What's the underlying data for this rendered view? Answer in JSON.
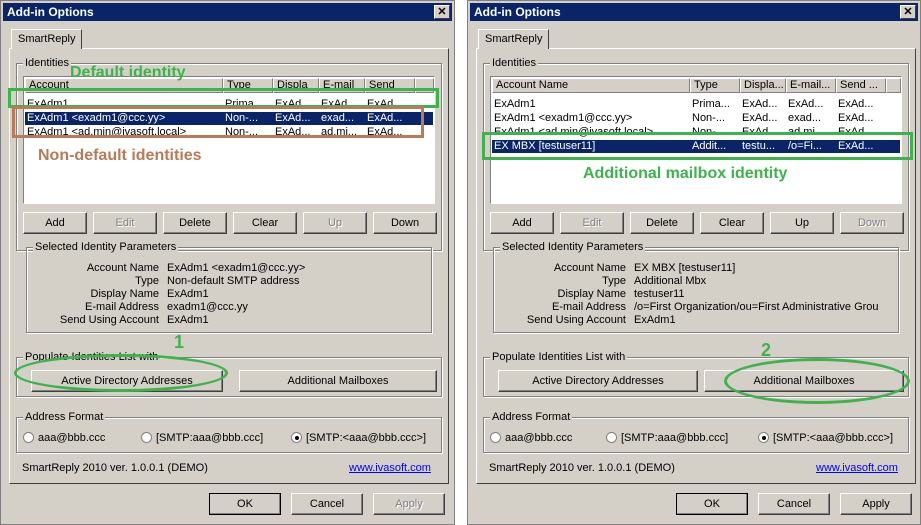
{
  "colors": {
    "green": "#3cb44b",
    "brown": "#b97a57",
    "selection": "#0a246a"
  },
  "left": {
    "title": "Add-in Options",
    "close_icon": "✕",
    "tab": "SmartReply",
    "identities_label": "Identities",
    "columns": [
      "Account",
      "Type",
      "Displa",
      "E-mail",
      "Send"
    ],
    "rows": [
      {
        "account": "ExAdm1",
        "type": "Prima...",
        "display": "ExAd...",
        "email": "ExAd...",
        "send": "ExAd...",
        "selected": false
      },
      {
        "account": "ExAdm1 <exadm1@ccc.yy>",
        "type": "Non-...",
        "display": "ExAd...",
        "email": "exad...",
        "send": "ExAd...",
        "selected": true
      },
      {
        "account": "ExAdm1 <ad.min@ivasoft.local>",
        "type": "Non-...",
        "display": "ExAd...",
        "email": "ad.mi...",
        "send": "ExAd...",
        "selected": false
      }
    ],
    "buttons": {
      "add": "Add",
      "edit": "Edit",
      "delete": "Delete",
      "clear": "Clear",
      "up": "Up",
      "down": "Down"
    },
    "params_label": "Selected Identity Parameters",
    "params": [
      {
        "label": "Account Name",
        "value": "ExAdm1 <exadm1@ccc.yy>"
      },
      {
        "label": "Type",
        "value": "Non-default SMTP address"
      },
      {
        "label": "Display Name",
        "value": "ExAdm1"
      },
      {
        "label": "E-mail Address",
        "value": "exadm1@ccc.yy"
      },
      {
        "label": "Send Using Account",
        "value": "ExAdm1"
      }
    ],
    "populate_label": "Populate Identities List with",
    "populate_ad": "Active Directory Addresses",
    "populate_mbx": "Additional Mailboxes",
    "format_label": "Address Format",
    "formats": [
      "aaa@bbb.ccc",
      "[SMTP:aaa@bbb.ccc]",
      "[SMTP:<aaa@bbb.ccc>]"
    ],
    "version": "SmartReply 2010 ver. 1.0.0.1 (DEMO)",
    "link": "www.ivasoft.com",
    "ok": "OK",
    "cancel": "Cancel",
    "apply": "Apply",
    "ann_default": "Default identity",
    "ann_nondefault": "Non-default identities",
    "ann_num": "1"
  },
  "right": {
    "title": "Add-in Options",
    "close_icon": "✕",
    "tab": "SmartReply",
    "identities_label": "Identities",
    "columns": [
      "Account Name",
      "Type",
      "Displa...",
      "E-mail...",
      "Send ..."
    ],
    "rows": [
      {
        "account": "ExAdm1",
        "type": "Prima...",
        "display": "ExAd...",
        "email": "ExAd...",
        "send": "ExAd...",
        "selected": false
      },
      {
        "account": "ExAdm1 <exadm1@ccc.yy>",
        "type": "Non-...",
        "display": "ExAd...",
        "email": "exad...",
        "send": "ExAd...",
        "selected": false
      },
      {
        "account": "ExAdm1 <ad.min@ivasoft.local>",
        "type": "Non-...",
        "display": "ExAd...",
        "email": "ad.mi...",
        "send": "ExAd...",
        "selected": false
      },
      {
        "account": "EX MBX [testuser11]",
        "type": "Addit...",
        "display": "testu...",
        "email": "/o=Fi...",
        "send": "ExAd...",
        "selected": true
      }
    ],
    "buttons": {
      "add": "Add",
      "edit": "Edit",
      "delete": "Delete",
      "clear": "Clear",
      "up": "Up",
      "down": "Down"
    },
    "params_label": "Selected Identity Parameters",
    "params": [
      {
        "label": "Account Name",
        "value": "EX MBX [testuser11]"
      },
      {
        "label": "Type",
        "value": "Additional Mbx"
      },
      {
        "label": "Display Name",
        "value": "testuser11"
      },
      {
        "label": "E-mail Address",
        "value": "/o=First  Organization/ou=First  Administrative Grou"
      },
      {
        "label": "Send Using Account",
        "value": "ExAdm1"
      }
    ],
    "populate_label": "Populate Identities List with",
    "populate_ad": "Active Directory Addresses",
    "populate_mbx": "Additional Mailboxes",
    "format_label": "Address Format",
    "formats": [
      "aaa@bbb.ccc",
      "[SMTP:aaa@bbb.ccc]",
      "[SMTP:<aaa@bbb.ccc>]"
    ],
    "version": "SmartReply 2010 ver. 1.0.0.1 (DEMO)",
    "link": "www.ivasoft.com",
    "ok": "OK",
    "cancel": "Cancel",
    "apply": "Apply",
    "ann_additional": "Additional mailbox identity",
    "ann_num": "2"
  }
}
